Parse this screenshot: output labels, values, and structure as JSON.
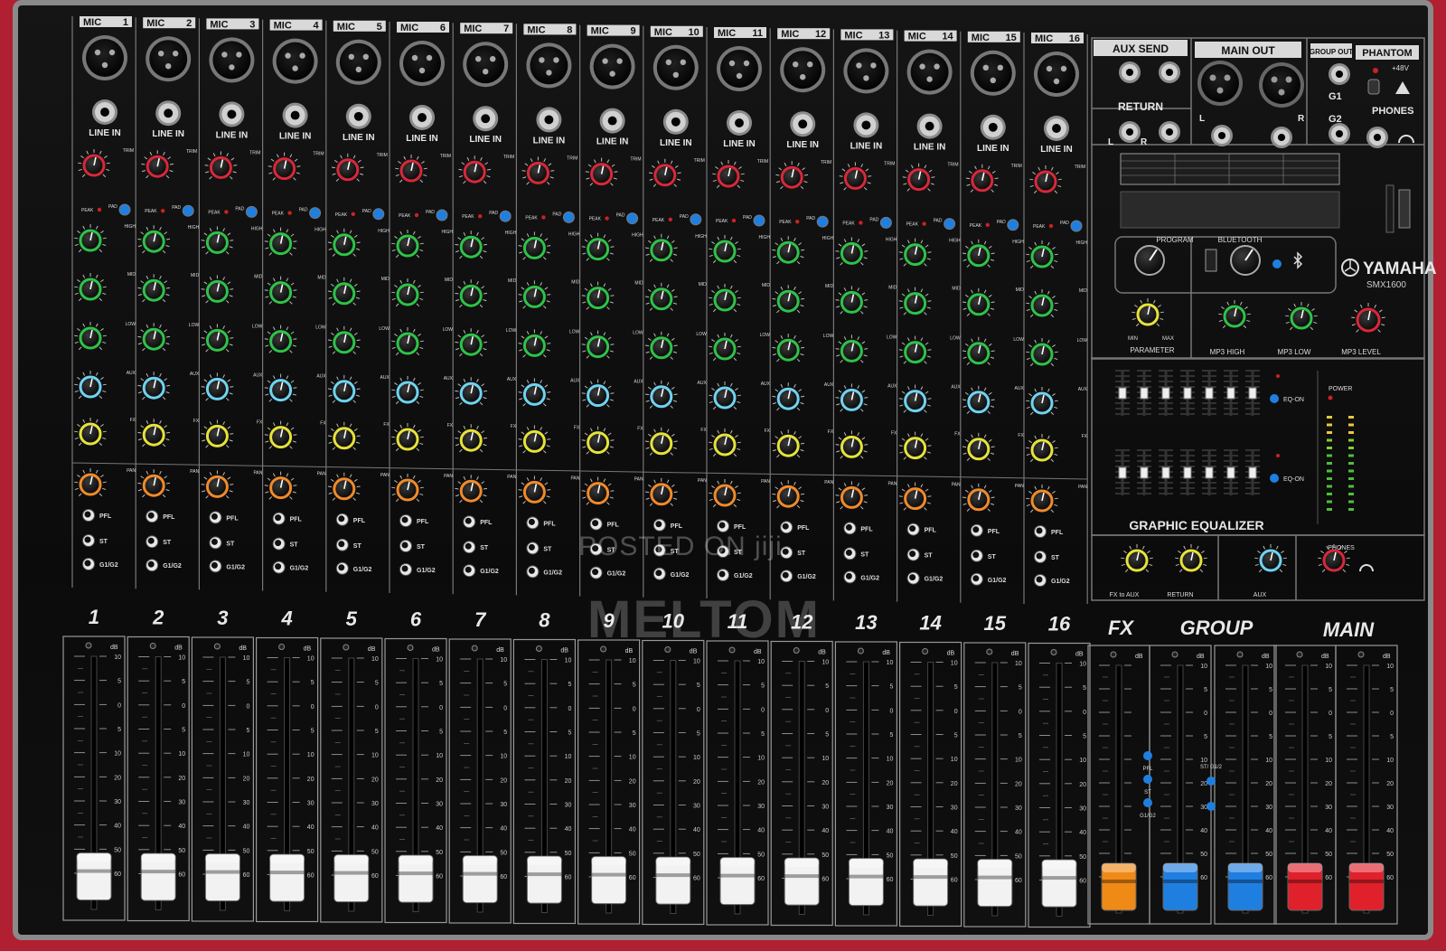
{
  "channels": [
    {
      "mic": "MIC",
      "num": "1",
      "fader": "1"
    },
    {
      "mic": "MIC",
      "num": "2",
      "fader": "2"
    },
    {
      "mic": "MIC",
      "num": "3",
      "fader": "3"
    },
    {
      "mic": "MIC",
      "num": "4",
      "fader": "4"
    },
    {
      "mic": "MIC",
      "num": "5",
      "fader": "5"
    },
    {
      "mic": "MIC",
      "num": "6",
      "fader": "6"
    },
    {
      "mic": "MIC",
      "num": "7",
      "fader": "7"
    },
    {
      "mic": "MIC",
      "num": "8",
      "fader": "8"
    },
    {
      "mic": "MIC",
      "num": "9",
      "fader": "9"
    },
    {
      "mic": "MIC",
      "num": "10",
      "fader": "10"
    },
    {
      "mic": "MIC",
      "num": "11",
      "fader": "11"
    },
    {
      "mic": "MIC",
      "num": "12",
      "fader": "12"
    },
    {
      "mic": "MIC",
      "num": "13",
      "fader": "13"
    },
    {
      "mic": "MIC",
      "num": "14",
      "fader": "14"
    },
    {
      "mic": "MIC",
      "num": "15",
      "fader": "15"
    },
    {
      "mic": "MIC",
      "num": "16",
      "fader": "16"
    }
  ],
  "strip_labels": {
    "line_in": "LINE IN",
    "trim": "TRIM",
    "peak": "PEAK",
    "pad": "PAD",
    "high": "HIGH",
    "mid": "MID",
    "low": "LOW",
    "aux": "AUX",
    "fx": "FX",
    "pan": "PAN",
    "pfl": "PFL",
    "st": "ST",
    "g1g2": "G1/G2",
    "db": "dB"
  },
  "fader_scale": [
    "10",
    "5",
    "0",
    "5",
    "10",
    "20",
    "30",
    "40",
    "50",
    "60"
  ],
  "master": {
    "aux_send": "AUX SEND",
    "return": "RETURN",
    "main_out": "MAIN OUT",
    "group_out": "GROUP OUT",
    "phantom": "PHANTOM",
    "phantom_volts": "+48V",
    "g1": "G1",
    "g2": "G2",
    "phones": "PHONES",
    "l": "L",
    "r": "R",
    "program": "PROGRAM",
    "bluetooth": "BLUETOOTH",
    "parameter": "PARAMETER",
    "min": "MIN",
    "max": "MAX",
    "mp3_high": "MP3 HIGH",
    "mp3_low": "MP3 LOW",
    "mp3_level": "MP3 LEVEL",
    "brand": "YAMAHA",
    "model": "SMX1600",
    "eq_on": "EQ-ON",
    "power": "POWER",
    "graphic_equalizer": "GRAPHIC EQUALIZER",
    "fx_to_aux": "FX to AUX",
    "aux": "AUX",
    "fx_label": "FX",
    "group_label": "GROUP",
    "main_label": "MAIN",
    "st_g12": "ST/ G1/2"
  },
  "fader_levels": {
    "channel": 0.06,
    "fx": 0.03,
    "group": 0.03,
    "main": 0.03
  },
  "knob_colors": {
    "trim": "#d8283a",
    "high": "#2fc248",
    "mid": "#2fc248",
    "low": "#2fc248",
    "aux": "#6fd3f0",
    "fx": "#e6e23a",
    "pan": "#f08a2a"
  },
  "fader_cap_colors": {
    "channel": "#f2f2f2",
    "fx": "#f08a16",
    "group": "#1f7fe0",
    "main": "#e0212b"
  },
  "watermark": {
    "posted": "POSTED ON jiji",
    "seller": "MELTOM"
  }
}
